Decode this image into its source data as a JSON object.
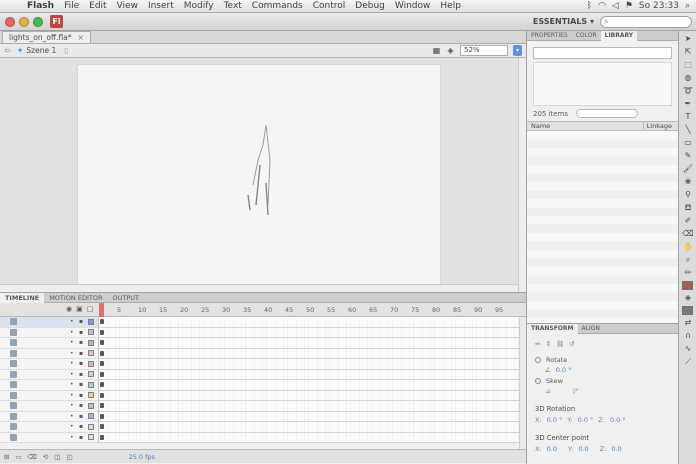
{
  "menubar": {
    "app": "Flash",
    "items": [
      "File",
      "Edit",
      "View",
      "Insert",
      "Modify",
      "Text",
      "Commands",
      "Control",
      "Debug",
      "Window",
      "Help"
    ],
    "clock": "So 23:33"
  },
  "app": {
    "icon_text": "Fl",
    "workspace": "ESSENTIALS ▾"
  },
  "document": {
    "tab_title": "lights_on_off.fla*",
    "scene": "Szene 1",
    "zoom": "52%"
  },
  "panels": {
    "timeline_tabs": [
      "TIMELINE",
      "MOTION EDITOR",
      "OUTPUT"
    ],
    "right_tabs": [
      "PROPERTIES",
      "COLOR",
      "LIBRARY"
    ],
    "transform_tabs": [
      "TRANSFORM",
      "ALIGN"
    ]
  },
  "timeline": {
    "ruler": [
      "5",
      "10",
      "15",
      "20",
      "25",
      "30",
      "35",
      "40",
      "45",
      "50",
      "55",
      "60",
      "65",
      "70",
      "75",
      "80",
      "85",
      "90",
      "95"
    ],
    "fps": "25.0 fps"
  },
  "library": {
    "item_count": "205 items",
    "col_name": "Name",
    "col_linkage": "Linkage"
  },
  "transform": {
    "rotate_label": "Rotate",
    "rotate_value": "0.0 °",
    "skew_label": "Skew",
    "section_3d_rot": "3D Rotation",
    "section_3d_center": "3D Center point",
    "x_label": "X:",
    "y_label": "Y:",
    "z_label": "Z:",
    "rot_x": "0.0 °",
    "rot_y": "0.0 °",
    "rot_z": "0.0 °",
    "c_x": "0.0",
    "c_y": "0.0",
    "c_z": "0.0"
  },
  "colors": {
    "accent": "#3b7ad9",
    "flash_red": "#b01d1d",
    "stroke_swatch": "#8a3b2c",
    "fill_swatch": "#5a5a5a"
  }
}
